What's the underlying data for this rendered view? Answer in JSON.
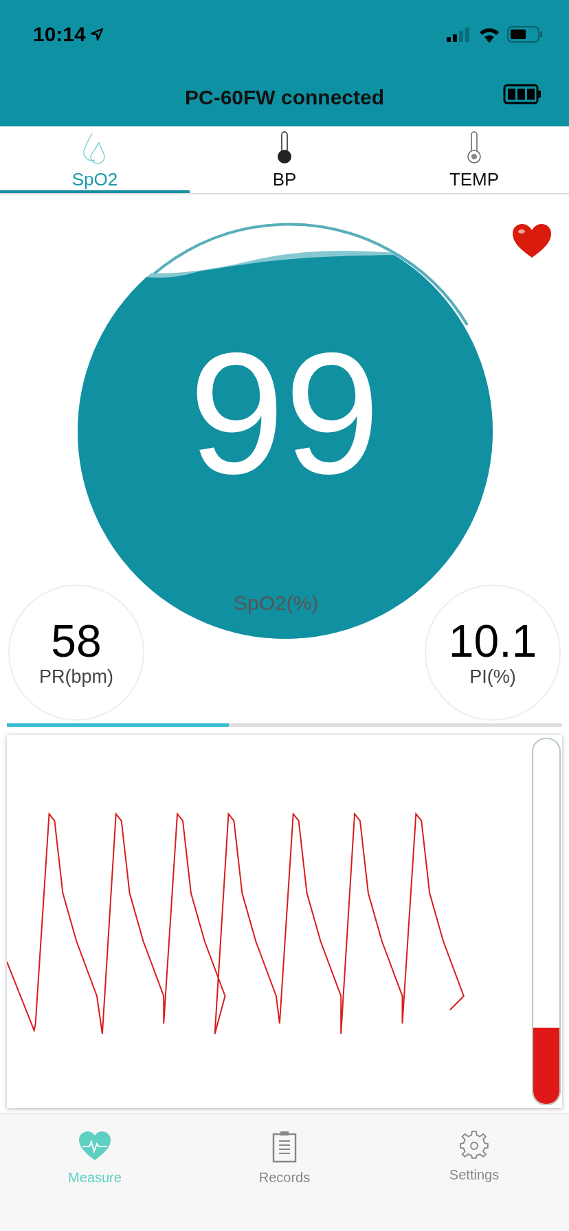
{
  "status_bar": {
    "time": "10:14"
  },
  "header": {
    "title": "PC-60FW connected"
  },
  "tabs": [
    {
      "label": "SpO2",
      "selected": true,
      "kind": "drops"
    },
    {
      "label": "BP",
      "selected": false,
      "kind": "thermometer-full"
    },
    {
      "label": "TEMP",
      "selected": false,
      "kind": "thermometer"
    }
  ],
  "main_reading": {
    "value": "99",
    "unit": "SpO2(%)"
  },
  "side_readings": [
    {
      "value": "58",
      "unit": "PR(bpm)"
    },
    {
      "value": "10.1",
      "unit": "PI(%)"
    }
  ],
  "progress": {
    "level": 0.4
  },
  "pulse_bar": {
    "level": 0.21
  },
  "bottom_nav": [
    {
      "label": "Measure",
      "selected": true,
      "kind": "heart"
    },
    {
      "label": "Records",
      "selected": false,
      "kind": "clipboard"
    },
    {
      "label": "Settings",
      "selected": false,
      "kind": "gear"
    }
  ]
}
